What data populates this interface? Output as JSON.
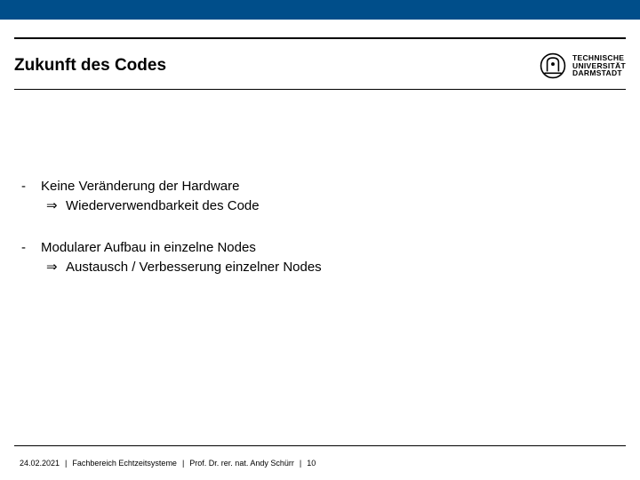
{
  "header": {
    "title": "Zukunft des Codes",
    "university": {
      "line1": "TECHNISCHE",
      "line2": "UNIVERSITÄT",
      "line3": "DARMSTADT"
    }
  },
  "bullets": [
    {
      "main": "Keine Veränderung der Hardware",
      "sub": "Wiederverwendbarkeit des Code"
    },
    {
      "main": "Modularer Aufbau in einzelne Nodes",
      "sub": "Austausch / Verbesserung einzelner Nodes"
    }
  ],
  "footer": {
    "date": "24.02.2021",
    "department": "Fachbereich Echtzeitsysteme",
    "author": "Prof. Dr. rer. nat. Andy Schürr",
    "page": "10"
  },
  "dash": "-",
  "arrow": "⇒",
  "sep": "|"
}
